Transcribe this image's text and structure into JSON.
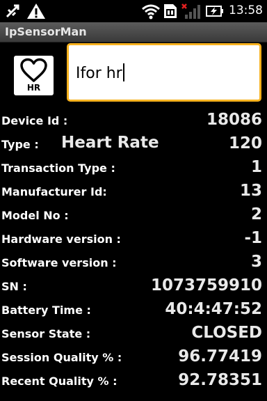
{
  "status_bar": {
    "time": "13:58",
    "icons": [
      "usb-debug-icon",
      "warning-icon",
      "wifi-icon",
      "sim-card-icon",
      "signal-no-service-icon",
      "battery-charging-icon"
    ]
  },
  "app": {
    "title": "IpSensorMan"
  },
  "sensor_icon": {
    "label": "HR"
  },
  "input": {
    "value": "Ifor hr"
  },
  "type_name": "Heart Rate",
  "rows": [
    {
      "label": "Device Id :",
      "value": "18086"
    },
    {
      "label": "Type :",
      "value": "120"
    },
    {
      "label": "Transaction Type :",
      "value": "1"
    },
    {
      "label": "Manufacturer Id:",
      "value": "13"
    },
    {
      "label": "Model No :",
      "value": "2"
    },
    {
      "label": "Hardware version :",
      "value": "-1"
    },
    {
      "label": "Software version :",
      "value": "3"
    },
    {
      "label": "SN :",
      "value": "1073759910"
    },
    {
      "label": "Battery Time :",
      "value": "40:4:47:52"
    },
    {
      "label": "Sensor State :",
      "value": "CLOSED"
    },
    {
      "label": "Session Quality % :",
      "value": "96.77419"
    },
    {
      "label": "Recent Quality % :",
      "value": "92.78351"
    }
  ]
}
